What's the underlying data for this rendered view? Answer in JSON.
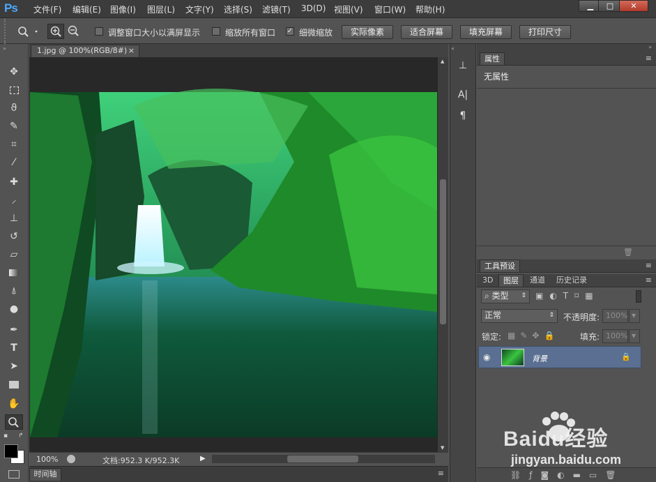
{
  "app": {
    "logo": "Ps"
  },
  "menu": [
    "文件(F)",
    "编辑(E)",
    "图像(I)",
    "图层(L)",
    "文字(Y)",
    "选择(S)",
    "滤镜(T)",
    "3D(D)",
    "视图(V)",
    "窗口(W)",
    "帮助(H)"
  ],
  "window_controls": {
    "minimize": "▁",
    "maximize": "□",
    "close": "✕"
  },
  "options": {
    "resize_windows": {
      "label": "调整窗口大小以满屏显示",
      "checked": false
    },
    "zoom_all": {
      "label": "缩放所有窗口",
      "checked": false
    },
    "scrubby_zoom": {
      "label": "细微缩放",
      "checked": true,
      "mark": "✓"
    },
    "buttons": [
      "实际像素",
      "适合屏幕",
      "填充屏幕",
      "打印尺寸"
    ]
  },
  "document": {
    "tab_title": "1.jpg @ 100%(RGB/8#)",
    "tab_close": "×"
  },
  "status": {
    "zoom": "100%",
    "doc_info": "文档:952.3 K/952.3K"
  },
  "timeline": {
    "label": "时间轴"
  },
  "properties": {
    "tab": "属性",
    "content": "无属性"
  },
  "tool_presets": {
    "tab": "工具预设"
  },
  "layers_panel": {
    "tabs": [
      "3D",
      "图层",
      "通道",
      "历史记录"
    ],
    "filter_kind": "类型",
    "blend_mode": "正常",
    "opacity_label": "不透明度:",
    "opacity_value": "100%",
    "lock_label": "锁定:",
    "fill_label": "填充:",
    "fill_value": "100%",
    "layers": [
      {
        "name": "背景",
        "visible": true,
        "locked": true
      }
    ]
  },
  "watermark": {
    "brand": "Baidu经验",
    "url": "jingyan.baidu.com"
  },
  "colors": {
    "accent": "#4aa9ff",
    "selected_layer": "#5a6f91"
  }
}
